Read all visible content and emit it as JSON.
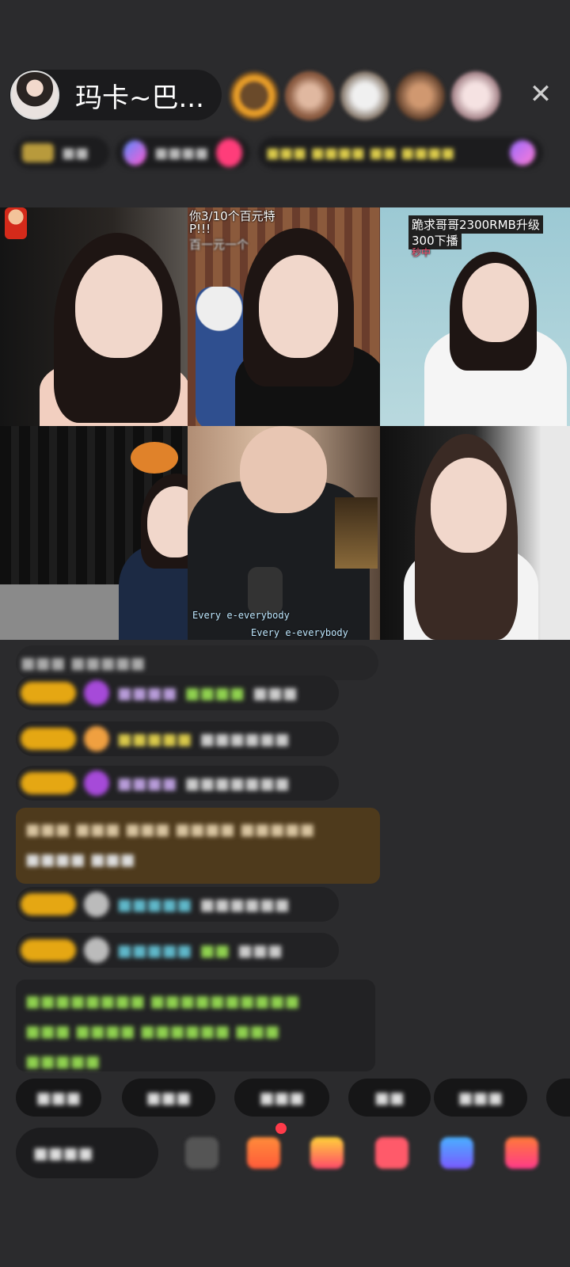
{
  "header": {
    "host_name": "玛卡~巴...",
    "close_symbol": "✕",
    "viewer_avatar_colors": [
      "#c98c3a",
      "#b58972",
      "#d9d2cc",
      "#a88060",
      "#c9a5a8"
    ]
  },
  "grid": {
    "tile2_banner": "你3/10个百元特",
    "tile2_banner_line2": "P!!!",
    "tile2_banner_line3": "百一元一个",
    "tile3_tag_line1": "跪求哥哥2300RMB升级",
    "tile3_tag_line2": "300下播",
    "tile3_small_tag": "秒中",
    "tile5_caption_a": "Every e-everybody",
    "tile5_caption_b": "Every e-everybody"
  },
  "chat": {
    "accent_gold": "#e5a713",
    "accent_purple": "#a64ad9",
    "message_green": "#8fd14f"
  },
  "colors": {
    "background": "#2b2b2d",
    "pill": "#1b1b1d",
    "notification_dot": "#ff3b4a"
  }
}
